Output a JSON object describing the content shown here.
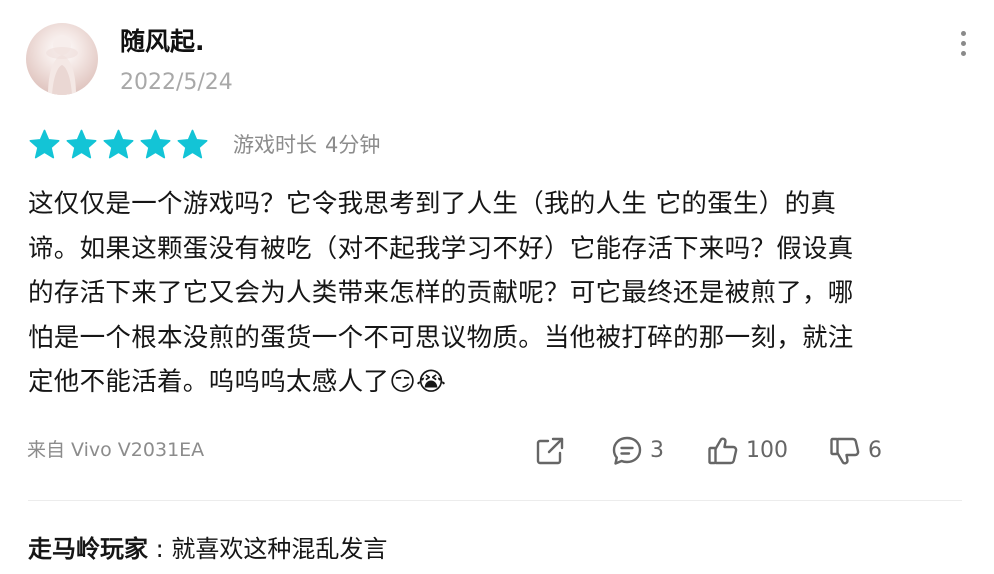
{
  "review": {
    "username": "随风起.",
    "date": "2022/5/24",
    "rating": 5,
    "max_rating": 5,
    "star_color": "#13c4d6",
    "playtime_label": "游戏时长",
    "playtime_value": "4分钟",
    "lines": [
      "这仅仅是一个游戏吗？它令我思考到了人生（我的人生 它的蛋生）的真",
      "谛。如果这颗蛋没有被吃（对不起我学习不好）它能存活下来吗？假设真",
      "的存活下来了它又会为人类带来怎样的贡献呢？可它最终还是被煎了，哪",
      "怕是一个根本没煎的蛋货一个不可思议物质。当他被打碎的那一刻，就注",
      "定他不能活着。呜呜呜太感人了😏😭"
    ],
    "device": "来自 Vivo V2031EA"
  },
  "actions": {
    "share_icon": "share-icon",
    "comment_icon": "comment-icon",
    "comment_count": "3",
    "like_icon": "thumbs-up-icon",
    "like_count": "100",
    "dislike_icon": "thumbs-down-icon",
    "dislike_count": "6"
  },
  "reply": {
    "user": "走马岭玩家",
    "separator": " : ",
    "text": "就喜欢这种混乱发言"
  }
}
